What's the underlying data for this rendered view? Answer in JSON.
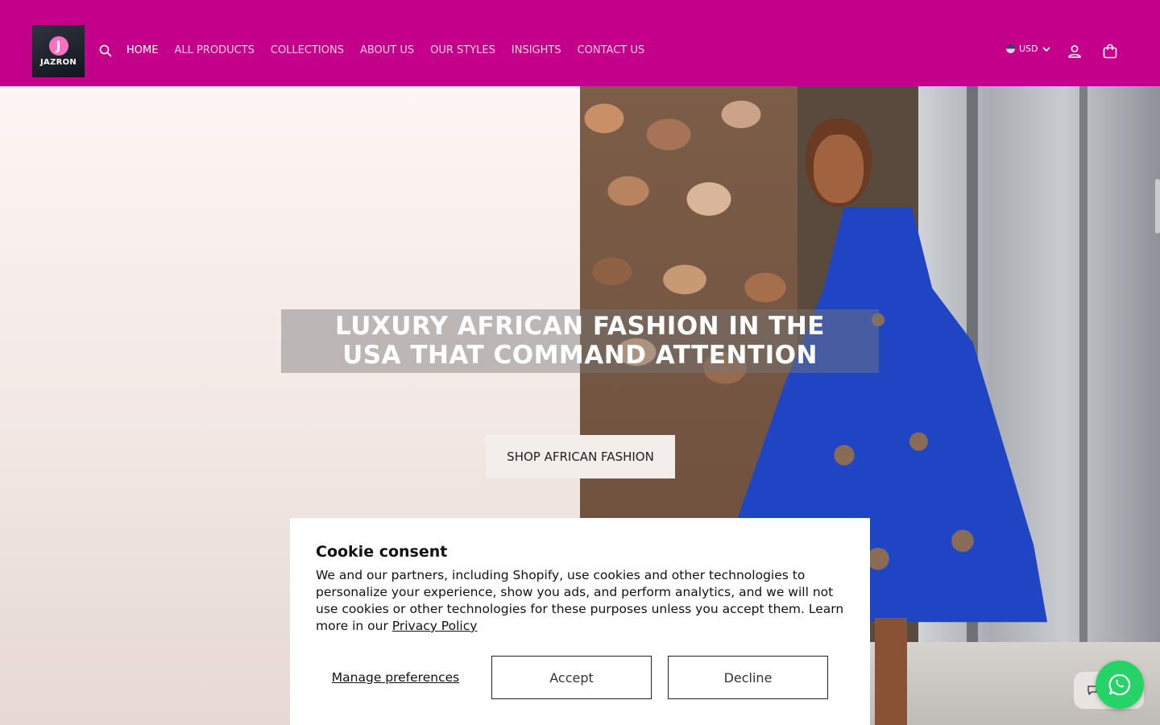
{
  "brand": {
    "logo_letter": "J",
    "logo_text": "JAZRON"
  },
  "header": {
    "nav": [
      {
        "label": "HOME",
        "active": true
      },
      {
        "label": "ALL PRODUCTS",
        "active": false
      },
      {
        "label": "COLLECTIONS",
        "active": false
      },
      {
        "label": "ABOUT US",
        "active": false
      },
      {
        "label": "OUR STYLES",
        "active": false
      },
      {
        "label": "INSIGHTS",
        "active": false
      },
      {
        "label": "CONTACT US",
        "active": false
      }
    ],
    "currency": "USD",
    "icons": {
      "search": "search-icon",
      "account": "account-icon",
      "cart": "cart-icon"
    }
  },
  "hero": {
    "title_line1": "LUXURY AFRICAN FASHION IN THE",
    "title_line2": "USA THAT COMMAND ATTENTION",
    "cta_label": "SHOP AFRICAN FASHION"
  },
  "cookie": {
    "title": "Cookie consent",
    "body": "We and our partners, including Shopify, use cookies and other technologies to personalize your experience, show you ads, and perform analytics, and we will not use cookies or other technologies for these purposes unless you accept them. Learn more in our",
    "privacy_link": "Privacy Policy",
    "manage_label": "Manage preferences",
    "accept_label": "Accept",
    "decline_label": "Decline"
  },
  "widgets": {
    "chat_icon": "chat-icon",
    "whatsapp_icon": "whatsapp-icon"
  },
  "colors": {
    "header_bg": "#c4008a",
    "whatsapp": "#25d366",
    "hero_dress": "#1f45c4"
  }
}
